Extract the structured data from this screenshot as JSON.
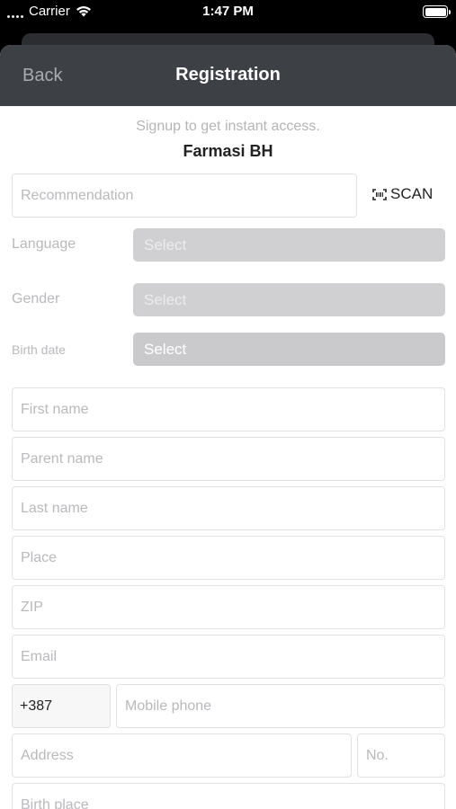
{
  "status_bar": {
    "carrier": "Carrier",
    "time": "1:47 PM"
  },
  "nav": {
    "back_label": "Back",
    "title": "Registration"
  },
  "header": {
    "subtitle": "Signup to get instant access.",
    "company": "Farmasi BH"
  },
  "recommendation": {
    "placeholder": "Recommendation",
    "scan_label": "SCAN"
  },
  "selects": {
    "language": {
      "label": "Language",
      "value": "Select"
    },
    "gender": {
      "label": "Gender",
      "value": "Select"
    },
    "birth_date": {
      "label": "Birth date",
      "value": "Select"
    }
  },
  "fields": {
    "first_name": "First name",
    "parent_name": "Parent name",
    "last_name": "Last name",
    "place": "Place",
    "zip": "ZIP",
    "email": "Email",
    "phone_prefix": "+387",
    "mobile_phone": "Mobile phone",
    "address": "Address",
    "number": "No.",
    "birth_place": "Birth place"
  }
}
